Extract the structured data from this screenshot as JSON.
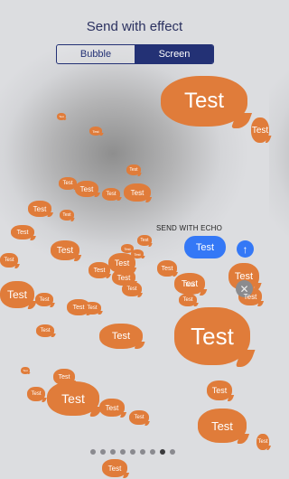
{
  "header": {
    "title": "Send with effect"
  },
  "segmented": {
    "bubble_label": "Bubble",
    "screen_label": "Screen",
    "selected": "Screen"
  },
  "effect": {
    "name_label": "SEND WITH ECHO"
  },
  "message": {
    "text": "Test"
  },
  "bubble_text": "Test",
  "page_indicator": {
    "count": 9,
    "current": 8
  },
  "colors": {
    "accent": "#233175",
    "bubble_orange": "#e07c3a",
    "imessage_blue": "#3478f6"
  },
  "icons": {
    "send": "arrow-up-icon",
    "close": "close-icon"
  }
}
